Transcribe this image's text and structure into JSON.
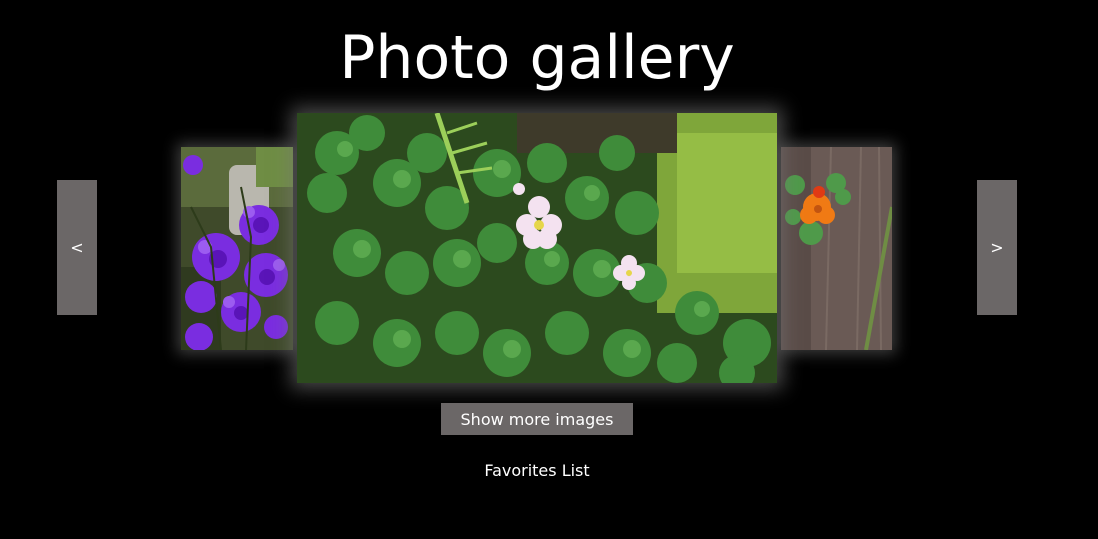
{
  "header": {
    "title": "Photo gallery"
  },
  "carousel": {
    "prev_label": "<",
    "next_label": ">",
    "images": [
      {
        "position": "left",
        "subject": "purple-flowers-photo"
      },
      {
        "position": "center",
        "subject": "clover-and-white-flowers-photo"
      },
      {
        "position": "right",
        "subject": "orange-flower-on-wood-photo"
      }
    ]
  },
  "actions": {
    "show_more_label": "Show more images"
  },
  "footer": {
    "favorites_label": "Favorites List"
  },
  "colors": {
    "background": "#000000",
    "button": "#6b6767",
    "text": "#ffffff"
  }
}
